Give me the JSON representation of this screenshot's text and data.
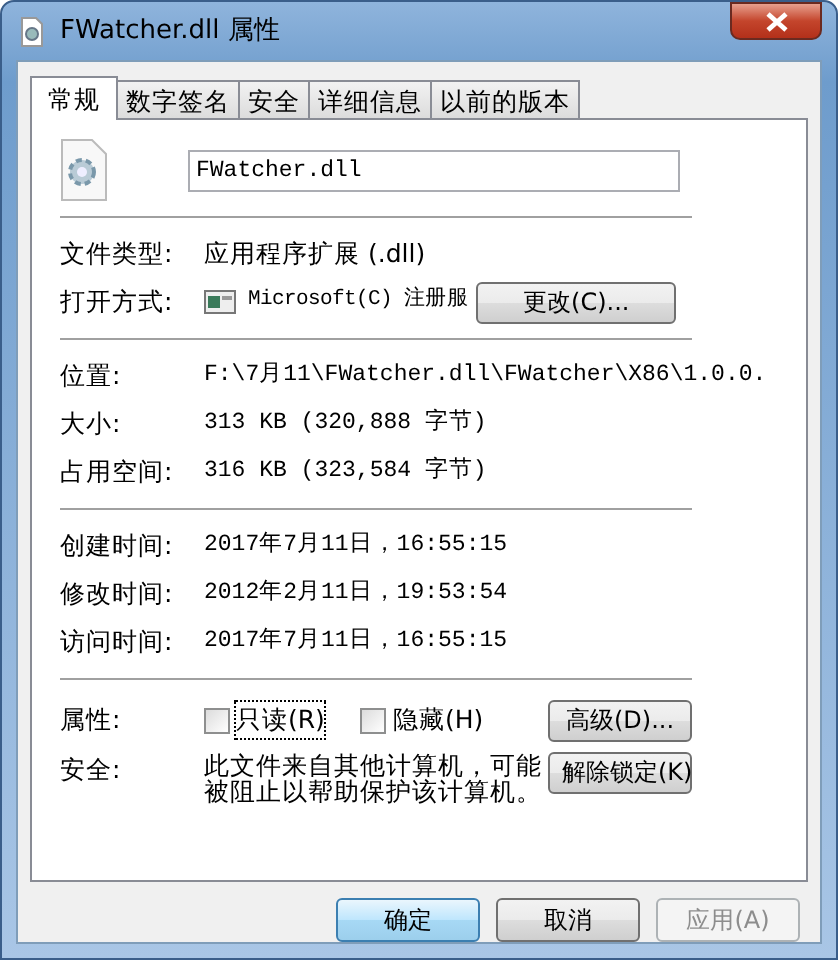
{
  "window": {
    "title": "FWatcher.dll 属性"
  },
  "tabs": [
    {
      "label": "常规",
      "selected": true
    },
    {
      "label": "数字签名",
      "selected": false
    },
    {
      "label": "安全",
      "selected": false
    },
    {
      "label": "详细信息",
      "selected": false
    },
    {
      "label": "以前的版本",
      "selected": false
    }
  ],
  "file_name": "FWatcher.dll",
  "file_type": {
    "label": "文件类型:",
    "value": "应用程序扩展 (.dll)"
  },
  "opens_with": {
    "label": "打开方式:",
    "value": "Microsoft(C) 注册服",
    "button": "更改(C)..."
  },
  "sections": [
    [
      {
        "label": "位置:",
        "value": "F:\\7月11\\FWatcher.dll\\FWatcher\\X86\\1.0.0."
      },
      {
        "label": "大小:",
        "value": "313 KB (320,888 字节)"
      },
      {
        "label": "占用空间:",
        "value": "316 KB (323,584 字节)"
      }
    ],
    [
      {
        "label": "创建时间:",
        "value": "2017年7月11日，16:55:15"
      },
      {
        "label": "修改时间:",
        "value": "2012年2月11日，19:53:54"
      },
      {
        "label": "访问时间:",
        "value": "2017年7月11日，16:55:15"
      }
    ]
  ],
  "attributes": {
    "label": "属性:",
    "options": [
      {
        "label": "只读(R)",
        "checked": false,
        "focused": true
      },
      {
        "label": "隐藏(H)",
        "checked": false,
        "focused": false
      }
    ],
    "button": "高级(D)..."
  },
  "security": {
    "label": "安全:",
    "text": "此文件来自其他计算机，可能被阻止以帮助保护该计算机。",
    "button": "解除锁定(K)"
  },
  "buttons": [
    {
      "label": "确定",
      "default": true,
      "disabled": false
    },
    {
      "label": "取消",
      "default": false,
      "disabled": false
    },
    {
      "label": "应用(A)",
      "default": false,
      "disabled": true
    }
  ]
}
